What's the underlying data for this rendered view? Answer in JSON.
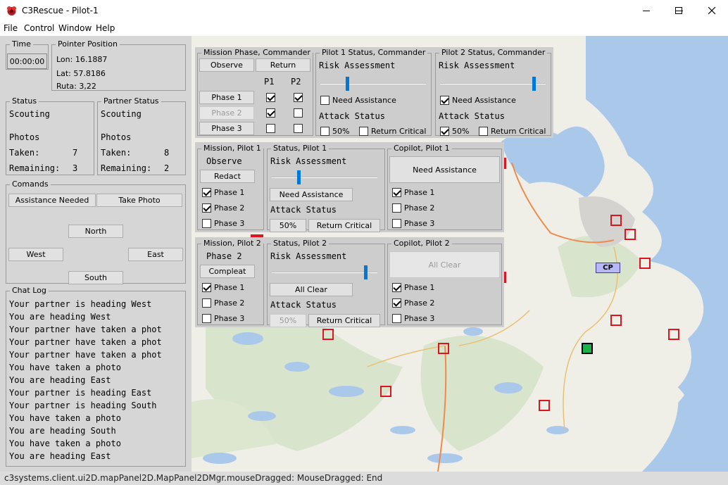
{
  "window": {
    "title": "C3Rescue - Pilot-1"
  },
  "menu": [
    "File",
    "Control",
    "Window",
    "Help"
  ],
  "time": {
    "label": "Time",
    "value": "00:00:00"
  },
  "pointer": {
    "label": "Pointer Position",
    "lon": "Lon: 16.1887",
    "lat": "Lat: 57.8186",
    "ruta": "Ruta: 3,22"
  },
  "status": {
    "label": "Status",
    "state": "Scouting",
    "photos": "Photos",
    "taken_label": "Taken:",
    "taken": "7",
    "remaining_label": "Remaining:",
    "remaining": "3"
  },
  "partner_status": {
    "label": "Partner Status",
    "state": "Scouting",
    "photos": "Photos",
    "taken_label": "Taken:",
    "taken": "8",
    "remaining_label": "Remaining:",
    "remaining": "2"
  },
  "commands": {
    "label": "Comands",
    "assistance": "Assistance Needed",
    "take_photo": "Take Photo",
    "north": "North",
    "west": "West",
    "east": "East",
    "south": "South"
  },
  "chat": {
    "label": "Chat Log",
    "lines": [
      "Your partner is heading West",
      "You are heading West",
      "Your partner have taken a phot",
      "Your partner have taken a phot",
      "Your partner have taken a phot",
      "You have taken a photo",
      "You are heading East",
      "Your partner is heading East",
      "Your partner is heading South",
      "You have taken a photo",
      "You are heading South",
      "You have taken a photo",
      "You are heading East"
    ]
  },
  "mission_commander": {
    "label": "Mission Phase, Commander",
    "observe": "Observe",
    "return": "Return",
    "p1": "P1",
    "p2": "P2",
    "phases": [
      {
        "label": "Phase 1",
        "p1": true,
        "p2": true,
        "disabled": false
      },
      {
        "label": "Phase 2",
        "p1": true,
        "p2": false,
        "disabled": true
      },
      {
        "label": "Phase 3",
        "p1": false,
        "p2": false,
        "disabled": false
      }
    ]
  },
  "pilot1_commander": {
    "label": "Pilot 1 Status, Commander",
    "risk": "Risk Assessment",
    "risk_level": 0.25,
    "need_assistance": "Need Assistance",
    "need_checked": false,
    "attack": "Attack Status",
    "pct": "50%",
    "pct_checked": false,
    "return_critical": "Return Critical",
    "rc_checked": false
  },
  "pilot2_commander": {
    "label": "Pilot 2 Status, Commander",
    "risk": "Risk Assessment",
    "risk_level": 0.9,
    "need_assistance": "Need Assistance",
    "need_checked": true,
    "attack": "Attack Status",
    "pct": "50%",
    "pct_checked": true,
    "return_critical": "Return Critical",
    "rc_checked": false
  },
  "mission_pilot1": {
    "label": "Mission, Pilot 1",
    "state": "Observe",
    "button": "Redact",
    "phases": [
      {
        "label": "Phase 1",
        "checked": true
      },
      {
        "label": "Phase 2",
        "checked": true
      },
      {
        "label": "Phase 3",
        "checked": false
      }
    ]
  },
  "status_pilot1": {
    "label": "Status, Pilot 1",
    "risk": "Risk Assessment",
    "risk_level": 0.25,
    "assist_button": "Need Assistance",
    "attack": "Attack Status",
    "pct_button": "50%",
    "pct_disabled": false,
    "return_critical": "Return Critical"
  },
  "copilot1": {
    "label": "Copilot, Pilot 1",
    "button": "Need Assistance",
    "button_disabled": false,
    "phases": [
      {
        "label": "Phase 1",
        "checked": true
      },
      {
        "label": "Phase 2",
        "checked": false
      },
      {
        "label": "Phase 3",
        "checked": false
      }
    ]
  },
  "mission_pilot2": {
    "label": "Mission, Pilot 2",
    "state": "Phase 2",
    "button": "Compleat",
    "phases": [
      {
        "label": "Phase 1",
        "checked": true
      },
      {
        "label": "Phase 2",
        "checked": false
      },
      {
        "label": "Phase 3",
        "checked": false
      }
    ]
  },
  "status_pilot2": {
    "label": "Status, Pilot 2",
    "risk": "Risk Assessment",
    "risk_level": 0.9,
    "assist_button": "All Clear",
    "attack": "Attack Status",
    "pct_button": "50%",
    "pct_disabled": true,
    "return_critical": "Return Critical"
  },
  "copilot2": {
    "label": "Copilot, Pilot 2",
    "button": "All Clear",
    "button_disabled": true,
    "phases": [
      {
        "label": "Phase 1",
        "checked": true
      },
      {
        "label": "Phase 2",
        "checked": true
      },
      {
        "label": "Phase 3",
        "checked": false
      }
    ]
  },
  "map": {
    "cp_label": "CP",
    "water_color": "#aac9ea",
    "land_color": "#efeee7",
    "forest_color": "#d9e4cc",
    "marker_color": "#e0141e",
    "target_color": "#19b34a"
  },
  "status_bar": "c3systems.client.ui2D.mapPanel2D.MapPanel2DMgr.mouseDragged:  MouseDragged: End"
}
